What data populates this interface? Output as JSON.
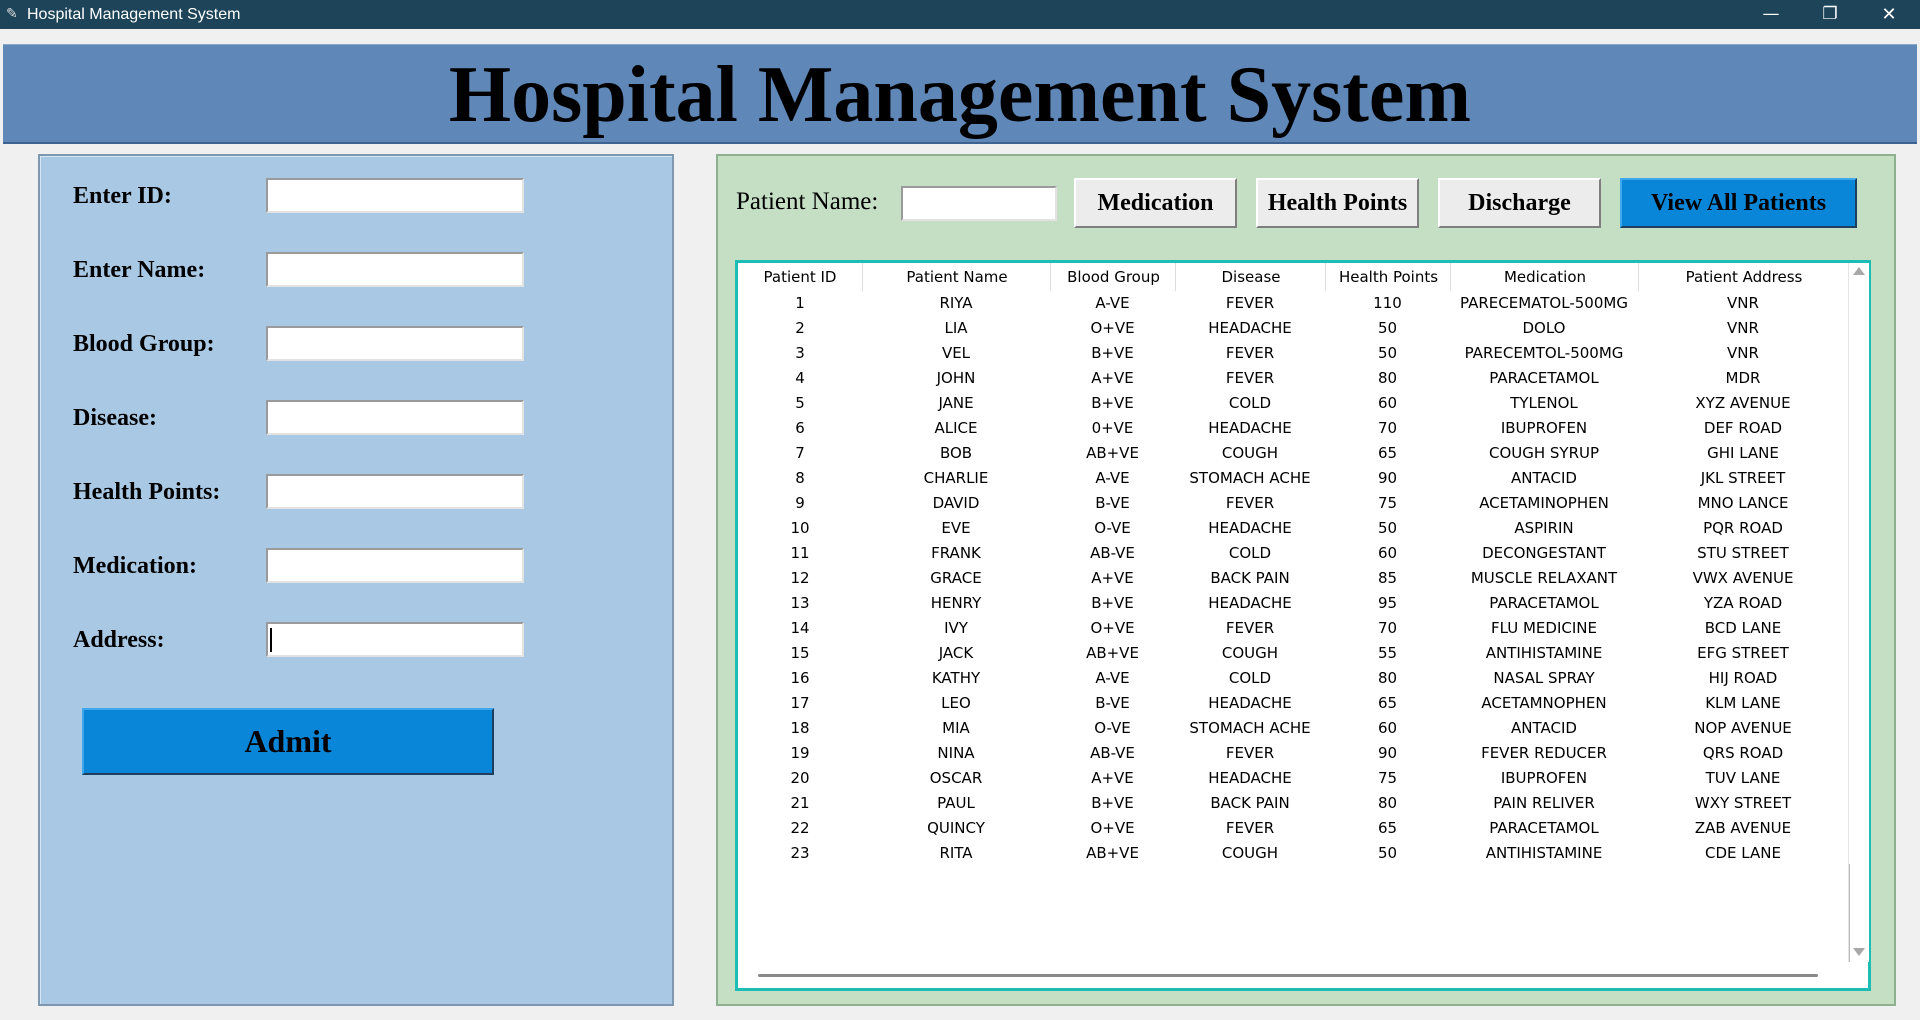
{
  "window": {
    "title": "Hospital Management System",
    "controls": {
      "minimize": "—",
      "restore": "❐",
      "close": "✕"
    }
  },
  "header": {
    "title": "Hospital Management System"
  },
  "form": {
    "fields": [
      {
        "label": "Enter ID:",
        "value": ""
      },
      {
        "label": "Enter Name:",
        "value": ""
      },
      {
        "label": "Blood Group:",
        "value": ""
      },
      {
        "label": "Disease:",
        "value": ""
      },
      {
        "label": "Health Points:",
        "value": ""
      },
      {
        "label": "Medication:",
        "value": ""
      },
      {
        "label": "Address:",
        "value": ""
      }
    ],
    "admit_label": "Admit"
  },
  "toolbar": {
    "search_label": "Patient Name:",
    "search_value": "",
    "medication_label": "Medication",
    "health_points_label": "Health Points",
    "discharge_label": "Discharge",
    "view_all_label": "View All Patients"
  },
  "colors": {
    "accent_button": "#0a86d8",
    "header_bg": "#5f87b8",
    "form_bg": "#a8c8e4",
    "records_bg": "#c4dfc4",
    "table_border": "#1dbcb4"
  },
  "table": {
    "columns": [
      "Patient ID",
      "Patient Name",
      "Blood Group",
      "Disease",
      "Health Points",
      "Medication",
      "Patient Address"
    ],
    "rows": [
      [
        "1",
        "RIYA",
        "A-VE",
        "FEVER",
        "110",
        "PARECEMATOL-500MG",
        "VNR"
      ],
      [
        "2",
        "LIA",
        "O+VE",
        "HEADACHE",
        "50",
        "DOLO",
        "VNR"
      ],
      [
        "3",
        "VEL",
        "B+VE",
        "FEVER",
        "50",
        "PARECEMTOL-500MG",
        "VNR"
      ],
      [
        "4",
        "JOHN",
        "A+VE",
        "FEVER",
        "80",
        "PARACETAMOL",
        "MDR"
      ],
      [
        "5",
        "JANE",
        "B+VE",
        "COLD",
        "60",
        "TYLENOL",
        "XYZ AVENUE"
      ],
      [
        "6",
        "ALICE",
        "0+VE",
        "HEADACHE",
        "70",
        "IBUPROFEN",
        "DEF ROAD"
      ],
      [
        "7",
        "BOB",
        "AB+VE",
        "COUGH",
        "65",
        "COUGH SYRUP",
        "GHI LANE"
      ],
      [
        "8",
        "CHARLIE",
        "A-VE",
        "STOMACH ACHE",
        "90",
        "ANTACID",
        "JKL STREET"
      ],
      [
        "9",
        "DAVID",
        "B-VE",
        "FEVER",
        "75",
        "ACETAMINOPHEN",
        "MNO LANCE"
      ],
      [
        "10",
        "EVE",
        "O-VE",
        "HEADACHE",
        "50",
        "ASPIRIN",
        "PQR ROAD"
      ],
      [
        "11",
        "FRANK",
        "AB-VE",
        "COLD",
        "60",
        "DECONGESTANT",
        "STU STREET"
      ],
      [
        "12",
        "GRACE",
        "A+VE",
        "BACK PAIN",
        "85",
        "MUSCLE RELAXANT",
        "VWX AVENUE"
      ],
      [
        "13",
        "HENRY",
        "B+VE",
        "HEADACHE",
        "95",
        "PARACETAMOL",
        "YZA ROAD"
      ],
      [
        "14",
        "IVY",
        "O+VE",
        "FEVER",
        "70",
        "FLU MEDICINE",
        "BCD LANE"
      ],
      [
        "15",
        "JACK",
        "AB+VE",
        "COUGH",
        "55",
        "ANTIHISTAMINE",
        "EFG STREET"
      ],
      [
        "16",
        "KATHY",
        "A-VE",
        "COLD",
        "80",
        "NASAL SPRAY",
        "HIJ ROAD"
      ],
      [
        "17",
        "LEO",
        "B-VE",
        "HEADACHE",
        "65",
        "ACETAMNOPHEN",
        "KLM LANE"
      ],
      [
        "18",
        "MIA",
        "O-VE",
        "STOMACH ACHE",
        "60",
        "ANTACID",
        "NOP AVENUE"
      ],
      [
        "19",
        "NINA",
        "AB-VE",
        "FEVER",
        "90",
        "FEVER REDUCER",
        "QRS ROAD"
      ],
      [
        "20",
        "OSCAR",
        "A+VE",
        "HEADACHE",
        "75",
        "IBUPROFEN",
        "TUV LANE"
      ],
      [
        "21",
        "PAUL",
        "B+VE",
        "BACK PAIN",
        "80",
        "PAIN RELIVER",
        "WXY STREET"
      ],
      [
        "22",
        "QUINCY",
        "O+VE",
        "FEVER",
        "65",
        "PARACETAMOL",
        "ZAB AVENUE"
      ],
      [
        "23",
        "RITA",
        "AB+VE",
        "COUGH",
        "50",
        "ANTIHISTAMINE",
        "CDE LANE"
      ]
    ]
  }
}
